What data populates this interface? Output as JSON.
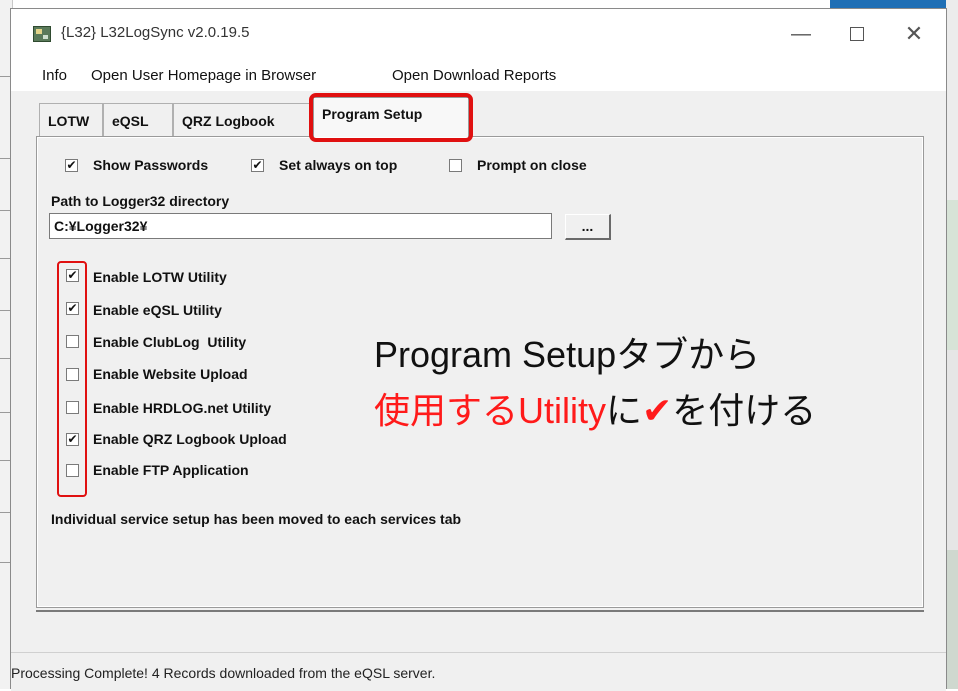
{
  "window": {
    "title": "{L32} L32LogSync v2.0.19.5",
    "minimize_icon": "minimize-icon",
    "maximize_icon": "maximize-icon",
    "close_icon": "close-icon"
  },
  "menu": {
    "items": [
      "Info",
      "Open User Homepage in Browser",
      "Open Download Reports"
    ]
  },
  "tabs": [
    {
      "label": "LOTW",
      "active": false
    },
    {
      "label": "eQSL",
      "active": false
    },
    {
      "label": "QRZ Logbook",
      "active": false
    },
    {
      "label": "Program Setup",
      "active": true
    }
  ],
  "options": [
    {
      "label": "Show Passwords",
      "checked": true
    },
    {
      "label": "Set always on top",
      "checked": true
    },
    {
      "label": "Prompt on close",
      "checked": false
    }
  ],
  "path": {
    "label": "Path to Logger32 directory",
    "value": "C:¥Logger32¥",
    "browse_label": "..."
  },
  "utilities": [
    {
      "label": "Enable LOTW Utility",
      "checked": true
    },
    {
      "label": "Enable eQSL Utility",
      "checked": true
    },
    {
      "label": "Enable ClubLog  Utility",
      "checked": false
    },
    {
      "label": "Enable Website Upload",
      "checked": false
    },
    {
      "label": "Enable HRDLOG.net Utility",
      "checked": false
    },
    {
      "label": "Enable QRZ Logbook Upload",
      "checked": true
    },
    {
      "label": "Enable FTP Application",
      "checked": false
    }
  ],
  "note": "Individual service setup has been moved to each services tab",
  "annotation": {
    "line1": "Program Setupタブから",
    "line2_red": "使用するUtility",
    "line2_mid": "に",
    "line2_check": "✔",
    "line2_end": "を付ける"
  },
  "status": "Processing Complete! 4 Records downloaded from the eQSL server.",
  "colors": {
    "highlight": "#e01010",
    "annotation_red": "#ff1a1a"
  }
}
